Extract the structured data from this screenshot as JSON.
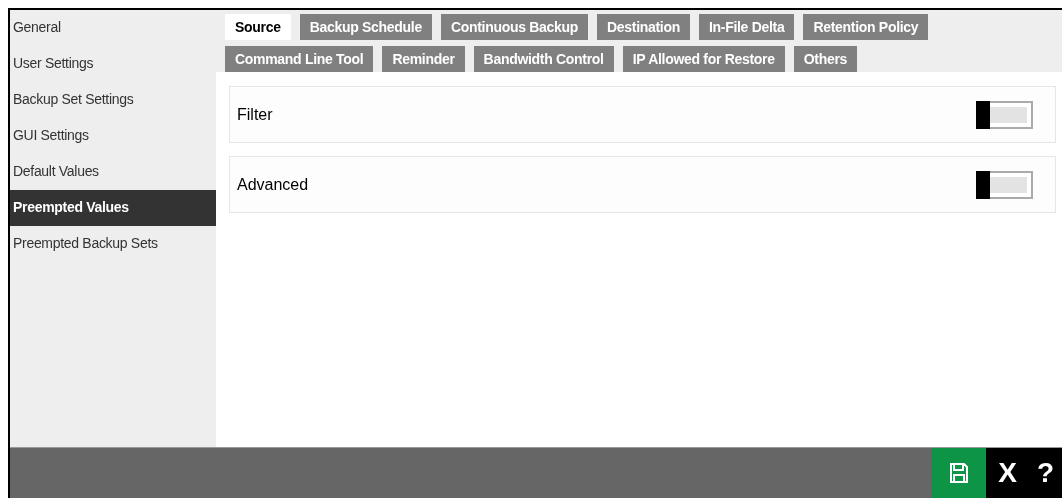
{
  "sidebar": {
    "items": [
      {
        "label": "General",
        "selected": false
      },
      {
        "label": "User Settings",
        "selected": false
      },
      {
        "label": "Backup Set Settings",
        "selected": false
      },
      {
        "label": "GUI Settings",
        "selected": false
      },
      {
        "label": "Default Values",
        "selected": false
      },
      {
        "label": "Preempted Values",
        "selected": true
      },
      {
        "label": "Preempted Backup Sets",
        "selected": false
      }
    ]
  },
  "tabs": [
    [
      {
        "label": "Source",
        "selected": true
      },
      {
        "label": "Backup Schedule",
        "selected": false
      },
      {
        "label": "Continuous Backup",
        "selected": false
      },
      {
        "label": "Destination",
        "selected": false
      },
      {
        "label": "In-File Delta",
        "selected": false
      },
      {
        "label": "Retention Policy",
        "selected": false
      }
    ],
    [
      {
        "label": "Command Line Tool",
        "selected": false
      },
      {
        "label": "Reminder",
        "selected": false
      },
      {
        "label": "Bandwidth Control",
        "selected": false
      },
      {
        "label": "IP Allowed for Restore",
        "selected": false
      },
      {
        "label": "Others",
        "selected": false
      }
    ]
  ],
  "sections": [
    {
      "title": "Filter",
      "on": false
    },
    {
      "title": "Advanced",
      "on": false
    }
  ],
  "footer": {
    "close_label": "X",
    "help_label": "?"
  }
}
